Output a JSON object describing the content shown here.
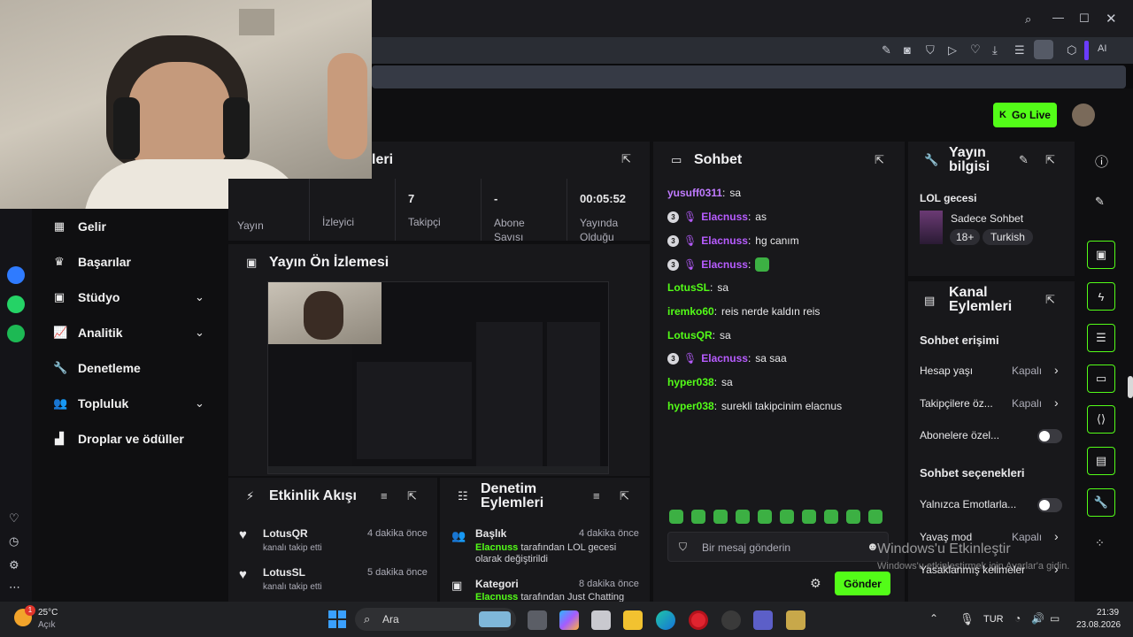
{
  "browser": {
    "ai_label": "AI"
  },
  "topbar": {
    "go_live": "Go Live"
  },
  "sidebar": {
    "items": [
      {
        "label": "Gelir"
      },
      {
        "label": "Başarılar"
      },
      {
        "label": "Stüdyo"
      },
      {
        "label": "Analitik"
      },
      {
        "label": "Denetleme"
      },
      {
        "label": "Topluluk"
      },
      {
        "label": "Droplar ve ödüller"
      }
    ]
  },
  "stats": {
    "title_partial": "leri",
    "cells": [
      {
        "value": "",
        "label": "Yayın"
      },
      {
        "value": "",
        "label": "İzleyici"
      },
      {
        "value": "7",
        "label": "Takipçi"
      },
      {
        "value": "-",
        "label": "Abone Savısı"
      },
      {
        "value": "00:05:52",
        "label": "Yayında Olduğu"
      }
    ]
  },
  "preview": {
    "title": "Yayın Ön İzlemesi"
  },
  "activity": {
    "title": "Etkinlik Akışı",
    "items": [
      {
        "user": "LotusQR",
        "action": "kanalı takip etti",
        "time": "4 dakika önce"
      },
      {
        "user": "LotusSL",
        "action": "kanalı takip etti",
        "time": "5 dakika önce"
      }
    ]
  },
  "moderation": {
    "title": "Denetim Eylemleri",
    "items": [
      {
        "title": "Başlık",
        "time": "4 dakika önce",
        "actor": "Elacnuss",
        "text": "tarafından LOL gecesi olarak değiştirildi"
      },
      {
        "title": "Kategori",
        "time": "8 dakika önce",
        "actor": "Elacnuss",
        "text": "tarafından Just Chatting"
      }
    ]
  },
  "chat": {
    "title": "Sohbet",
    "messages": [
      {
        "user": "yusuff0311",
        "text": "sa",
        "color": "#c07bff"
      },
      {
        "user": "Elacnuss",
        "text": "as",
        "color": "#b75cff"
      },
      {
        "user": "Elacnuss",
        "text": "hg canım",
        "color": "#b75cff"
      },
      {
        "user": "Elacnuss",
        "text": "",
        "color": "#b75cff"
      },
      {
        "user": "LotusSL",
        "text": "sa",
        "color": "#53fc18"
      },
      {
        "user": "iremko60",
        "text": "reis nerde kaldın reis",
        "color": "#53fc18"
      },
      {
        "user": "LotusQR",
        "text": "sa",
        "color": "#53fc18"
      },
      {
        "user": "Elacnuss",
        "text": "sa saa",
        "color": "#b75cff"
      },
      {
        "user": "hyper038",
        "text": "sa",
        "color": "#53fc18"
      },
      {
        "user": "hyper038",
        "text": "surekli takipcinim elacnus",
        "color": "#53fc18"
      }
    ],
    "input_placeholder": "Bir mesaj gönderin",
    "send": "Gönder"
  },
  "stream_info": {
    "title": "Yayın bilgisi",
    "stream_title": "LOL gecesi",
    "category": "Sadece Sohbet",
    "tags": [
      "18+",
      "Turkish"
    ]
  },
  "channel_actions": {
    "title": "Kanal Eylemleri",
    "chat_access": "Sohbet erişimi",
    "rows": [
      {
        "label": "Hesap yaşı",
        "value": "Kapalı"
      },
      {
        "label": "Takipçilere öz...",
        "value": "Kapalı"
      },
      {
        "label": "Abonelere özel...",
        "value": ""
      }
    ],
    "chat_options": "Sohbet seçenekleri",
    "rows2": [
      {
        "label": "Yalnızca Emotlarla...",
        "value": ""
      },
      {
        "label": "Yavaş mod",
        "value": "Kapalı"
      },
      {
        "label": "Yasaklanmış kelimeler",
        "value": ""
      }
    ]
  },
  "watermark": {
    "line1": "Windows'u Etkinleştir",
    "line2": "Windows'u etkinleştirmek için Ayarlar'a gidin."
  },
  "taskbar": {
    "temp": "25°C",
    "weather": "Açık",
    "search": "Ara",
    "lang": "TUR",
    "time": "21:39",
    "date": "23.08.2026"
  },
  "colors": {
    "accent": "#53fc18",
    "bg": "#0f0f11",
    "panel": "#18181b"
  }
}
